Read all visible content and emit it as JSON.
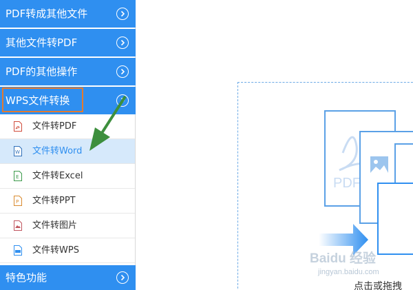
{
  "sidebar": {
    "categories": [
      {
        "label": "PDF转成其他文件"
      },
      {
        "label": "其他文件转PDF"
      },
      {
        "label": "PDF的其他操作"
      },
      {
        "label": "WPS文件转换"
      },
      {
        "label": "特色功能"
      }
    ],
    "sub_items": [
      {
        "label": "文件转PDF",
        "icon": "pdf-file-icon"
      },
      {
        "label": "文件转Word",
        "icon": "word-file-icon"
      },
      {
        "label": "文件转Excel",
        "icon": "excel-file-icon"
      },
      {
        "label": "文件转PPT",
        "icon": "ppt-file-icon"
      },
      {
        "label": "文件转图片",
        "icon": "image-file-icon"
      },
      {
        "label": "文件转WPS",
        "icon": "wps-file-icon"
      }
    ]
  },
  "main": {
    "illustration_label": "PDF",
    "hint": "点击或拖拽"
  },
  "watermark": {
    "text": "Baidu 经验",
    "url": "jingyan.baidu.com"
  },
  "colors": {
    "accent": "#2f8ff0",
    "active_bg": "#d6e9fb",
    "highlight_border": "#e47a2e",
    "annotation_arrow": "#3d8f3d"
  }
}
